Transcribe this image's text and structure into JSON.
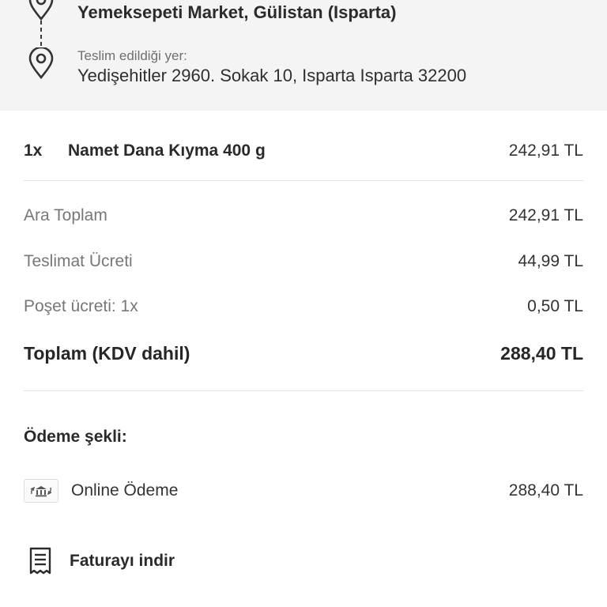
{
  "route": {
    "store_name": "Yemeksepeti Market, Gülistan (Isparta)",
    "delivery_label": "Teslim edildiği yer:",
    "delivery_address": "Yedişehitler 2960. Sokak 10, Isparta Isparta 32200"
  },
  "items": [
    {
      "qty": "1x",
      "name": "Namet Dana Kıyma 400 g",
      "price": "242,91 TL"
    }
  ],
  "summary": {
    "subtotal_label": "Ara Toplam",
    "subtotal_value": "242,91 TL",
    "delivery_fee_label": "Teslimat Ücreti",
    "delivery_fee_value": "44,99 TL",
    "bag_fee_label": "Poşet ücreti: 1x",
    "bag_fee_value": "0,50 TL",
    "total_label": "Toplam (KDV dahil)",
    "total_value": "288,40 TL"
  },
  "payment": {
    "title": "Ödeme şekli:",
    "method_label": "Online Ödeme",
    "method_amount": "288,40 TL",
    "method_icon": "bank-icon"
  },
  "invoice": {
    "label": "Faturayı indir",
    "icon": "receipt-icon"
  }
}
